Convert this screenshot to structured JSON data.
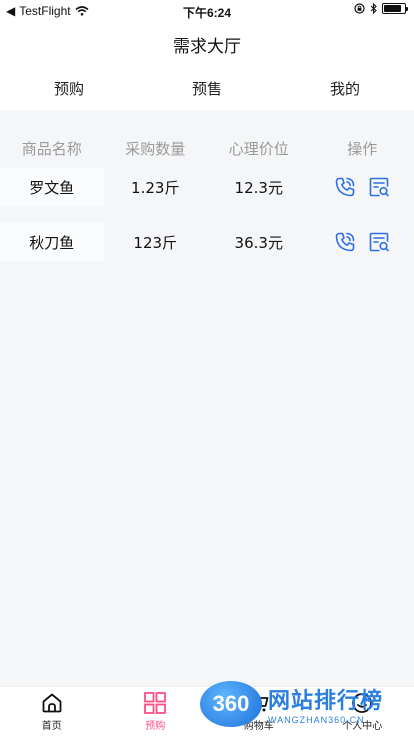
{
  "status_bar": {
    "back_app": "TestFlight",
    "time": "下午6:24"
  },
  "nav": {
    "title": "需求大厅"
  },
  "top_tabs": [
    {
      "label": "预购"
    },
    {
      "label": "预售"
    },
    {
      "label": "我的"
    }
  ],
  "table": {
    "headers": [
      "商品名称",
      "采购数量",
      "心理价位",
      "操作"
    ],
    "rows": [
      {
        "name": "罗文鱼",
        "quantity": "1.23斤",
        "price": "12.3元"
      },
      {
        "name": "秋刀鱼",
        "quantity": "123斤",
        "price": "36.3元"
      }
    ]
  },
  "tabbar": [
    {
      "label": "首页"
    },
    {
      "label": "预购"
    },
    {
      "label": "购物车"
    },
    {
      "label": "个人中心"
    }
  ],
  "colors": {
    "accent": "#ff4f86",
    "icon_blue": "#2f6fe6",
    "header_text": "#9a9a9a"
  },
  "watermark": {
    "badge": "360",
    "title": "网站排行榜",
    "url": "WANGZHAN360.CN"
  }
}
